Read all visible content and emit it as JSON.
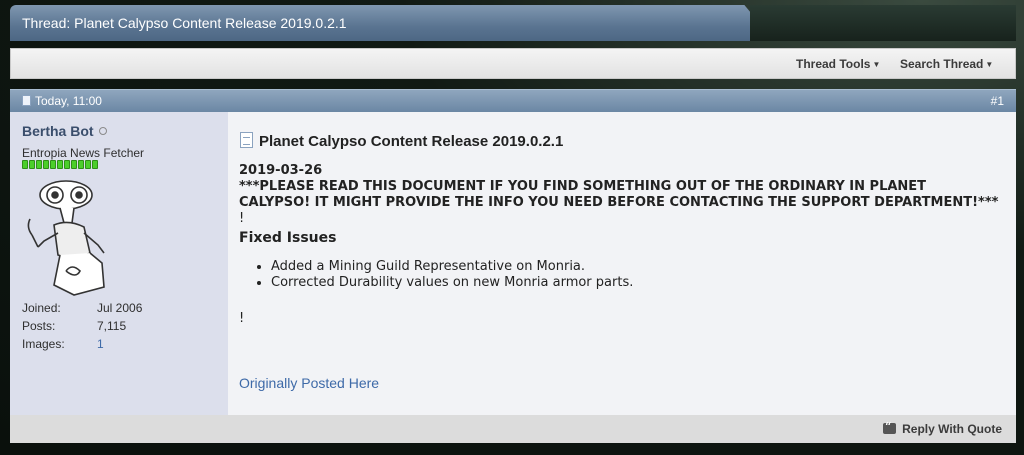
{
  "thread": {
    "title": "Thread: Planet Calypso Content Release 2019.0.2.1"
  },
  "toolbar": {
    "thread_tools": "Thread Tools",
    "search_thread": "Search Thread"
  },
  "post": {
    "date": "Today, 11:00",
    "number": "#1",
    "title": "Planet Calypso Content Release 2019.0.2.1",
    "date_line": "2019-03-26",
    "notice": "***PLEASE READ THIS DOCUMENT IF YOU FIND SOMETHING OUT OF THE ORDINARY IN PLANET CALYPSO! IT MIGHT PROVIDE THE INFO YOU NEED BEFORE CONTACTING THE SUPPORT DEPARTMENT!***",
    "excl1": "!",
    "section_title": "Fixed Issues",
    "fixes": [
      "Added a Mining Guild Representative on Monria.",
      "Corrected Durability values on new Monria armor parts."
    ],
    "excl2": "!",
    "original_link": "Originally Posted Here"
  },
  "user": {
    "name": "Bertha Bot",
    "title": "Entropia News Fetcher",
    "reputation_pips": 11,
    "stats": [
      {
        "label": "Joined:",
        "value": "Jul 2006"
      },
      {
        "label": "Posts:",
        "value": "7,115"
      },
      {
        "label": "Images:",
        "value": "1"
      }
    ]
  },
  "footer": {
    "reply_with_quote": "Reply With Quote"
  },
  "colors": {
    "header_blue": "#6b87a4",
    "link_blue": "#3e6aa8",
    "rep_green": "#4bcf2a"
  }
}
